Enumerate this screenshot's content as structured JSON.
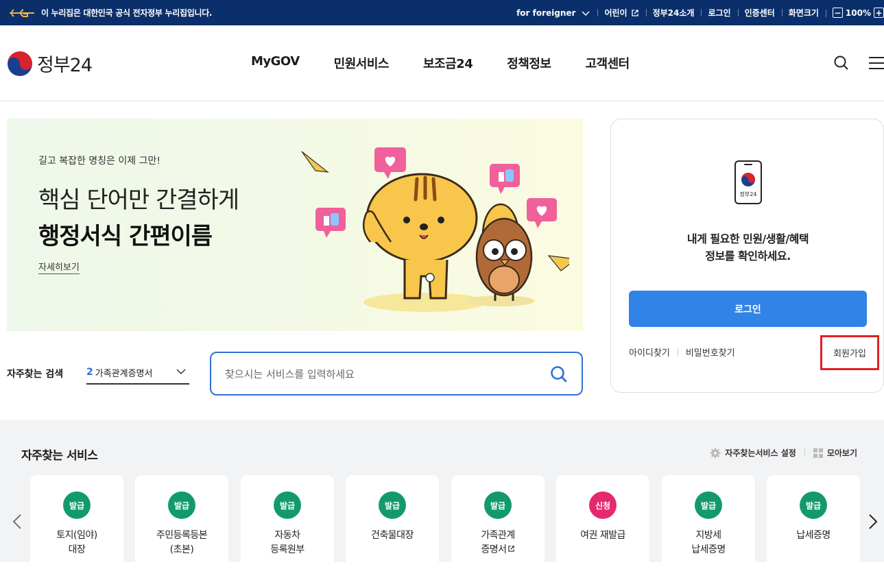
{
  "gov_bar": {
    "notice": "이 누리집은 대한민국 공식 전자정부 누리집입니다.",
    "foreigner": "for foreigner",
    "kids": "어린이",
    "about": "정부24소개",
    "login": "로그인",
    "cert_center": "인증센터",
    "screen_size": "화면크기",
    "zoom": "100%",
    "zoom_out": "−",
    "zoom_in": "+"
  },
  "header": {
    "logo_text": "정부24",
    "nav": [
      "MyGOV",
      "민원서비스",
      "보조금24",
      "정책정보",
      "고객센터"
    ]
  },
  "banner": {
    "subtitle": "길고 복잡한 명칭은 이제 그만!",
    "headline_1": "핵심 단어만 간결하게",
    "headline_2": "행정서식 간편이름",
    "more_link": "자세히보기"
  },
  "search": {
    "fav_label": "자주찾는 검색",
    "fav_rank": "2",
    "fav_value": "가족관계증명서",
    "placeholder": "찾으시는 서비스를 입력하세요"
  },
  "login_card": {
    "phone_label": "정부24",
    "message_1": "내게 필요한 민원/생활/혜택",
    "message_2": "정보를 확인하세요.",
    "login_button": "로그인",
    "find_id": "아이디찾기",
    "find_pw": "비밀번호찾기",
    "join": "회원가입"
  },
  "services": {
    "title": "자주찾는 서비스",
    "settings": "자주찾는서비스 설정",
    "view_all": "모아보기",
    "items": [
      {
        "badge": "발급",
        "line1": "토지(임야)",
        "line2": "대장",
        "color": "#139a6b"
      },
      {
        "badge": "발급",
        "line1": "주민등록등본",
        "line2": "(초본)",
        "color": "#139a6b"
      },
      {
        "badge": "발급",
        "line1": "자동차",
        "line2": "등록원부",
        "color": "#139a6b"
      },
      {
        "badge": "발급",
        "line1": "건축물대장",
        "line2": "",
        "color": "#139a6b"
      },
      {
        "badge": "발급",
        "line1": "가족관계",
        "line2": "증명서",
        "color": "#139a6b"
      },
      {
        "badge": "신청",
        "line1": "여권 재발급",
        "line2": "",
        "color": "#e5296f"
      },
      {
        "badge": "발급",
        "line1": "지방세",
        "line2": "납세증명",
        "color": "#139a6b"
      },
      {
        "badge": "발급",
        "line1": "납세증명",
        "line2": "",
        "color": "#139a6b"
      }
    ]
  }
}
